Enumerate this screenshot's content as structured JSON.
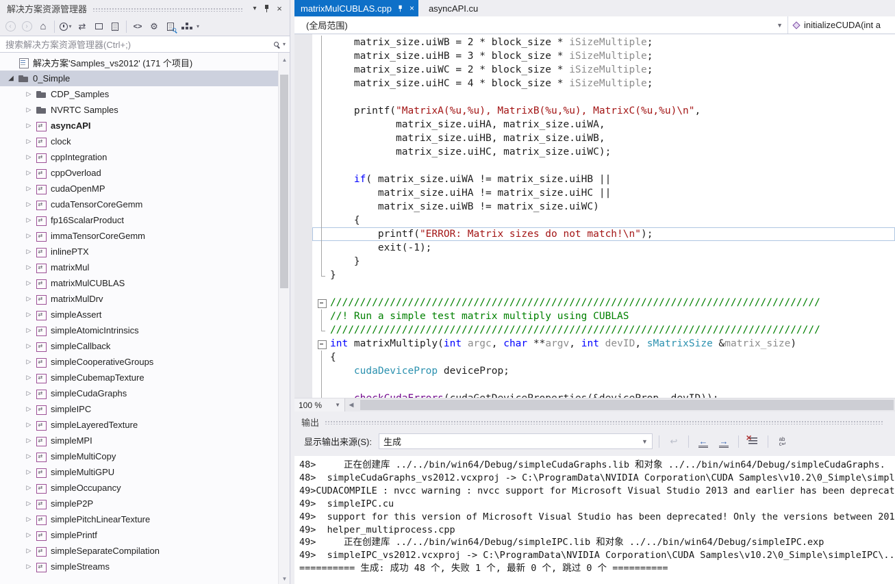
{
  "colors": {
    "active_tab": "#0E70C8",
    "selection": "#CDD1DE",
    "keyword": "#0000FF",
    "string": "#A31515",
    "comment": "#008000",
    "type": "#2B91AF",
    "macro": "#6F008A",
    "param": "#8C8C8C"
  },
  "solution_explorer": {
    "title": "解决方案资源管理器",
    "search_placeholder": "搜索解决方案资源管理器(Ctrl+;)",
    "tree": [
      {
        "label": "解决方案'Samples_vs2012' (171 个项目)",
        "type": "solution",
        "level": 0,
        "expander": "none",
        "bold": false,
        "selected": false
      },
      {
        "label": "0_Simple",
        "type": "folder",
        "level": 1,
        "expander": "expanded",
        "bold": false,
        "selected": true
      },
      {
        "label": "CDP_Samples",
        "type": "folder",
        "level": 2,
        "expander": "collapsed",
        "bold": false,
        "selected": false
      },
      {
        "label": "NVRTC Samples",
        "type": "folder",
        "level": 2,
        "expander": "collapsed",
        "bold": false,
        "selected": false
      },
      {
        "label": "asyncAPI",
        "type": "project",
        "level": 2,
        "expander": "collapsed",
        "bold": true,
        "selected": false
      },
      {
        "label": "clock",
        "type": "project",
        "level": 2,
        "expander": "collapsed",
        "bold": false,
        "selected": false
      },
      {
        "label": "cppIntegration",
        "type": "project",
        "level": 2,
        "expander": "collapsed",
        "bold": false,
        "selected": false
      },
      {
        "label": "cppOverload",
        "type": "project",
        "level": 2,
        "expander": "collapsed",
        "bold": false,
        "selected": false
      },
      {
        "label": "cudaOpenMP",
        "type": "project",
        "level": 2,
        "expander": "collapsed",
        "bold": false,
        "selected": false
      },
      {
        "label": "cudaTensorCoreGemm",
        "type": "project",
        "level": 2,
        "expander": "collapsed",
        "bold": false,
        "selected": false
      },
      {
        "label": "fp16ScalarProduct",
        "type": "project",
        "level": 2,
        "expander": "collapsed",
        "bold": false,
        "selected": false
      },
      {
        "label": "immaTensorCoreGemm",
        "type": "project",
        "level": 2,
        "expander": "collapsed",
        "bold": false,
        "selected": false
      },
      {
        "label": "inlinePTX",
        "type": "project",
        "level": 2,
        "expander": "collapsed",
        "bold": false,
        "selected": false
      },
      {
        "label": "matrixMul",
        "type": "project",
        "level": 2,
        "expander": "collapsed",
        "bold": false,
        "selected": false
      },
      {
        "label": "matrixMulCUBLAS",
        "type": "project",
        "level": 2,
        "expander": "collapsed",
        "bold": false,
        "selected": false
      },
      {
        "label": "matrixMulDrv",
        "type": "project",
        "level": 2,
        "expander": "collapsed",
        "bold": false,
        "selected": false
      },
      {
        "label": "simpleAssert",
        "type": "project",
        "level": 2,
        "expander": "collapsed",
        "bold": false,
        "selected": false
      },
      {
        "label": "simpleAtomicIntrinsics",
        "type": "project",
        "level": 2,
        "expander": "collapsed",
        "bold": false,
        "selected": false
      },
      {
        "label": "simpleCallback",
        "type": "project",
        "level": 2,
        "expander": "collapsed",
        "bold": false,
        "selected": false
      },
      {
        "label": "simpleCooperativeGroups",
        "type": "project",
        "level": 2,
        "expander": "collapsed",
        "bold": false,
        "selected": false
      },
      {
        "label": "simpleCubemapTexture",
        "type": "project",
        "level": 2,
        "expander": "collapsed",
        "bold": false,
        "selected": false
      },
      {
        "label": "simpleCudaGraphs",
        "type": "project",
        "level": 2,
        "expander": "collapsed",
        "bold": false,
        "selected": false
      },
      {
        "label": "simpleIPC",
        "type": "project",
        "level": 2,
        "expander": "collapsed",
        "bold": false,
        "selected": false
      },
      {
        "label": "simpleLayeredTexture",
        "type": "project",
        "level": 2,
        "expander": "collapsed",
        "bold": false,
        "selected": false
      },
      {
        "label": "simpleMPI",
        "type": "project",
        "level": 2,
        "expander": "collapsed",
        "bold": false,
        "selected": false
      },
      {
        "label": "simpleMultiCopy",
        "type": "project",
        "level": 2,
        "expander": "collapsed",
        "bold": false,
        "selected": false
      },
      {
        "label": "simpleMultiGPU",
        "type": "project",
        "level": 2,
        "expander": "collapsed",
        "bold": false,
        "selected": false
      },
      {
        "label": "simpleOccupancy",
        "type": "project",
        "level": 2,
        "expander": "collapsed",
        "bold": false,
        "selected": false
      },
      {
        "label": "simpleP2P",
        "type": "project",
        "level": 2,
        "expander": "collapsed",
        "bold": false,
        "selected": false
      },
      {
        "label": "simplePitchLinearTexture",
        "type": "project",
        "level": 2,
        "expander": "collapsed",
        "bold": false,
        "selected": false
      },
      {
        "label": "simplePrintf",
        "type": "project",
        "level": 2,
        "expander": "collapsed",
        "bold": false,
        "selected": false
      },
      {
        "label": "simpleSeparateCompilation",
        "type": "project",
        "level": 2,
        "expander": "collapsed",
        "bold": false,
        "selected": false
      },
      {
        "label": "simpleStreams",
        "type": "project",
        "level": 2,
        "expander": "collapsed",
        "bold": false,
        "selected": false
      }
    ]
  },
  "editor": {
    "tabs": [
      {
        "label": "matrixMulCUBLAS.cpp",
        "active": true
      },
      {
        "label": "asyncAPI.cu",
        "active": false
      }
    ],
    "scope_dropdown": "(全局范围)",
    "member_dropdown": "initializeCUDA(int a",
    "zoom_level": "100 %",
    "code_lines": [
      {
        "f": "l",
        "cur": false,
        "t": [
          [
            "p",
            "    matrix_size.uiWB = 2 * block_size * "
          ],
          [
            "g",
            "iSizeMultiple"
          ],
          [
            "p",
            ";"
          ]
        ]
      },
      {
        "f": "l",
        "cur": false,
        "t": [
          [
            "p",
            "    matrix_size.uiHB = 3 * block_size * "
          ],
          [
            "g",
            "iSizeMultiple"
          ],
          [
            "p",
            ";"
          ]
        ]
      },
      {
        "f": "l",
        "cur": false,
        "t": [
          [
            "p",
            "    matrix_size.uiWC = 2 * block_size * "
          ],
          [
            "g",
            "iSizeMultiple"
          ],
          [
            "p",
            ";"
          ]
        ]
      },
      {
        "f": "l",
        "cur": false,
        "t": [
          [
            "p",
            "    matrix_size.uiHC = 4 * block_size * "
          ],
          [
            "g",
            "iSizeMultiple"
          ],
          [
            "p",
            ";"
          ]
        ]
      },
      {
        "f": "l",
        "cur": false,
        "t": []
      },
      {
        "f": "l",
        "cur": false,
        "t": [
          [
            "p",
            "    printf("
          ],
          [
            "s",
            "\"MatrixA(%u,%u), MatrixB(%u,%u), MatrixC(%u,%u)\\n\""
          ],
          [
            "p",
            ","
          ]
        ]
      },
      {
        "f": "l",
        "cur": false,
        "t": [
          [
            "p",
            "           matrix_size.uiHA, matrix_size.uiWA,"
          ]
        ]
      },
      {
        "f": "l",
        "cur": false,
        "t": [
          [
            "p",
            "           matrix_size.uiHB, matrix_size.uiWB,"
          ]
        ]
      },
      {
        "f": "l",
        "cur": false,
        "t": [
          [
            "p",
            "           matrix_size.uiHC, matrix_size.uiWC);"
          ]
        ]
      },
      {
        "f": "l",
        "cur": false,
        "t": []
      },
      {
        "f": "l",
        "cur": false,
        "t": [
          [
            "p",
            "    "
          ],
          [
            "k",
            "if"
          ],
          [
            "p",
            "( matrix_size.uiWA != matrix_size.uiHB ||"
          ]
        ]
      },
      {
        "f": "l",
        "cur": false,
        "t": [
          [
            "p",
            "        matrix_size.uiHA != matrix_size.uiHC ||"
          ]
        ]
      },
      {
        "f": "l",
        "cur": false,
        "t": [
          [
            "p",
            "        matrix_size.uiWB != matrix_size.uiWC)"
          ]
        ]
      },
      {
        "f": "l",
        "cur": false,
        "t": [
          [
            "p",
            "    {"
          ]
        ]
      },
      {
        "f": "l",
        "cur": true,
        "t": [
          [
            "p",
            "        printf("
          ],
          [
            "s",
            "\"ERROR: Matrix sizes do not match!\\n\""
          ],
          [
            "p",
            ");"
          ]
        ]
      },
      {
        "f": "l",
        "cur": false,
        "t": [
          [
            "p",
            "        exit(-1);"
          ]
        ]
      },
      {
        "f": "l",
        "cur": false,
        "t": [
          [
            "p",
            "    }"
          ]
        ]
      },
      {
        "f": "e",
        "cur": false,
        "t": [
          [
            "p",
            "}"
          ]
        ]
      },
      {
        "f": "",
        "cur": false,
        "t": []
      },
      {
        "f": "b",
        "cur": false,
        "t": [
          [
            "c",
            "//////////////////////////////////////////////////////////////////////////////////"
          ]
        ]
      },
      {
        "f": "l",
        "cur": false,
        "t": [
          [
            "c",
            "//! Run a simple test matrix multiply using CUBLAS"
          ]
        ]
      },
      {
        "f": "e",
        "cur": false,
        "t": [
          [
            "c",
            "//////////////////////////////////////////////////////////////////////////////////"
          ]
        ]
      },
      {
        "f": "b",
        "cur": false,
        "t": [
          [
            "k",
            "int"
          ],
          [
            "p",
            " matrixMultiply("
          ],
          [
            "k",
            "int"
          ],
          [
            "p",
            " "
          ],
          [
            "g",
            "argc"
          ],
          [
            "p",
            ", "
          ],
          [
            "k",
            "char"
          ],
          [
            "p",
            " **"
          ],
          [
            "g",
            "argv"
          ],
          [
            "p",
            ", "
          ],
          [
            "k",
            "int"
          ],
          [
            "p",
            " "
          ],
          [
            "g",
            "devID"
          ],
          [
            "p",
            ", "
          ],
          [
            "t",
            "sMatrixSize"
          ],
          [
            "p",
            " &"
          ],
          [
            "g",
            "matrix_size"
          ],
          [
            "p",
            ")"
          ]
        ]
      },
      {
        "f": "l",
        "cur": false,
        "t": [
          [
            "p",
            "{"
          ]
        ]
      },
      {
        "f": "l",
        "cur": false,
        "t": [
          [
            "p",
            "    "
          ],
          [
            "t",
            "cudaDeviceProp"
          ],
          [
            "p",
            " deviceProp;"
          ]
        ]
      },
      {
        "f": "l",
        "cur": false,
        "t": []
      },
      {
        "f": "l",
        "cur": false,
        "t": [
          [
            "p",
            "    "
          ],
          [
            "m",
            "checkCudaErrors"
          ],
          [
            "p",
            "(cudaGetDeviceProperties(&deviceProp, devID));"
          ]
        ]
      }
    ]
  },
  "output": {
    "title": "输出",
    "source_label": "显示输出来源(S):",
    "source_value": "生成",
    "lines": [
      "48>     正在创建库 ../../bin/win64/Debug/simpleCudaGraphs.lib 和对象 ../../bin/win64/Debug/simpleCudaGraphs.",
      "48>  simpleCudaGraphs_vs2012.vcxproj -> C:\\ProgramData\\NVIDIA Corporation\\CUDA Samples\\v10.2\\0_Simple\\simpl",
      "49>CUDACOMPILE : nvcc warning : nvcc support for Microsoft Visual Studio 2013 and earlier has been deprecat",
      "49>  simpleIPC.cu",
      "49>  support for this version of Microsoft Visual Studio has been deprecated! Only the versions between 201",
      "49>  helper_multiprocess.cpp",
      "49>     正在创建库 ../../bin/win64/Debug/simpleIPC.lib 和对象 ../../bin/win64/Debug/simpleIPC.exp",
      "49>  simpleIPC_vs2012.vcxproj -> C:\\ProgramData\\NVIDIA Corporation\\CUDA Samples\\v10.2\\0_Simple\\simpleIPC\\...",
      "========== 生成: 成功 48 个, 失败 1 个, 最新 0 个, 跳过 0 个 =========="
    ]
  }
}
